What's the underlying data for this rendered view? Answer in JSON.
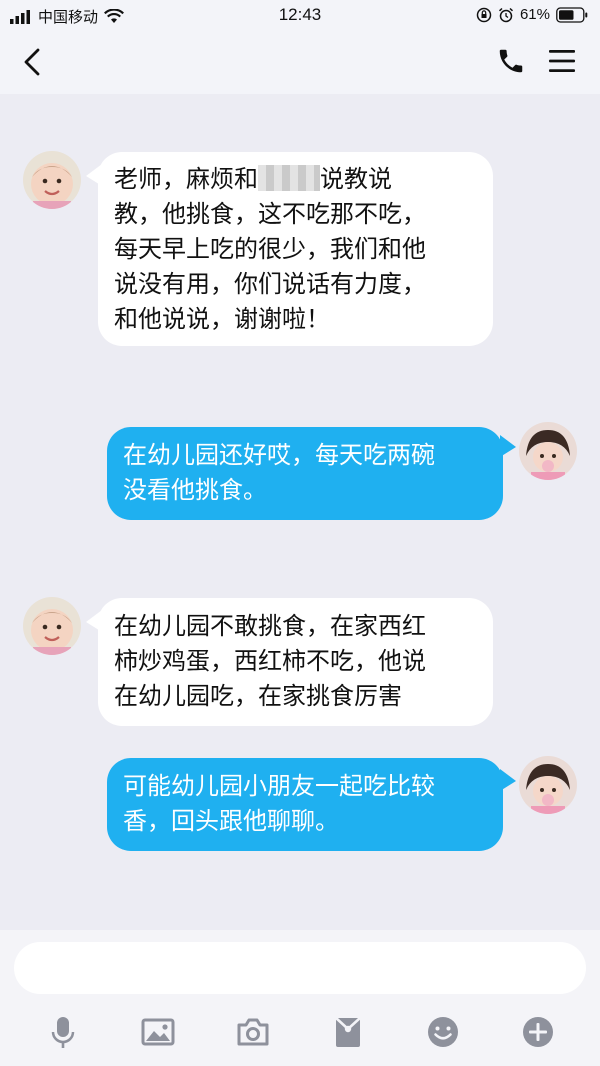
{
  "status_bar": {
    "carrier": "中国移动",
    "time": "12:43",
    "battery": "61%"
  },
  "colors": {
    "outgoing_bubble": "#1fb0f0",
    "incoming_bubble": "#ffffff",
    "icon": "#8e919c"
  },
  "messages": [
    {
      "side": "in",
      "lines": [
        "老师，麻烦和",
        "说教说",
        "教，他挑食，这不吃那不吃，",
        "每天早上吃的很少，我们和他",
        "说没有用，你们说话有力度，",
        "和他说说，谢谢啦！"
      ]
    },
    {
      "side": "out",
      "lines": [
        "在幼儿园还好哎，每天吃两碗",
        "没看他挑食。"
      ]
    },
    {
      "side": "in",
      "lines": [
        "在幼儿园不敢挑食，在家西红",
        "柿炒鸡蛋，西红柿不吃，他说",
        "在幼儿园吃，在家挑食厉害"
      ]
    },
    {
      "side": "out",
      "lines": [
        "可能幼儿园小朋友一起吃比较",
        "香，回头跟他聊聊。"
      ]
    }
  ],
  "toolbar_icons": [
    "microphone-icon",
    "image-icon",
    "camera-icon",
    "red-packet-icon",
    "emoji-icon",
    "plus-icon"
  ]
}
